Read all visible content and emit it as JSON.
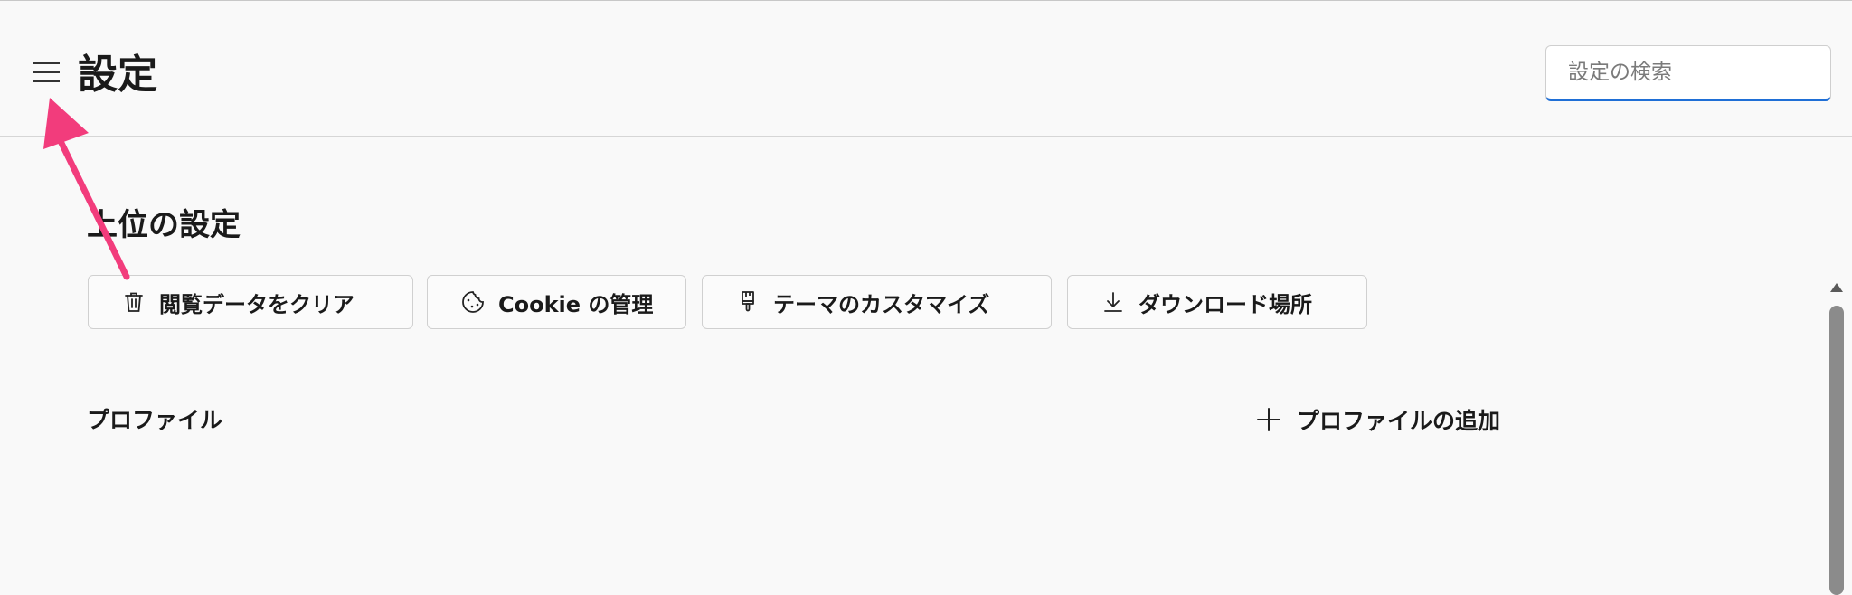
{
  "header": {
    "title": "設定",
    "search": {
      "placeholder": "設定の検索",
      "value": ""
    }
  },
  "main": {
    "section_title": "上位の設定",
    "quick_actions": [
      {
        "label": "閲覧データをクリア",
        "icon": "trash-icon"
      },
      {
        "label": "Cookie の管理",
        "icon": "cookie-icon"
      },
      {
        "label": "テーマのカスタマイズ",
        "icon": "paintbrush-icon"
      },
      {
        "label": "ダウンロード場所",
        "icon": "download-icon"
      }
    ],
    "profile": {
      "label": "プロファイル",
      "add_label": "プロファイルの追加"
    }
  },
  "colors": {
    "accent": "#1f6fd6",
    "annotation_arrow": "#f23c7c",
    "background": "#f9f9f9"
  }
}
